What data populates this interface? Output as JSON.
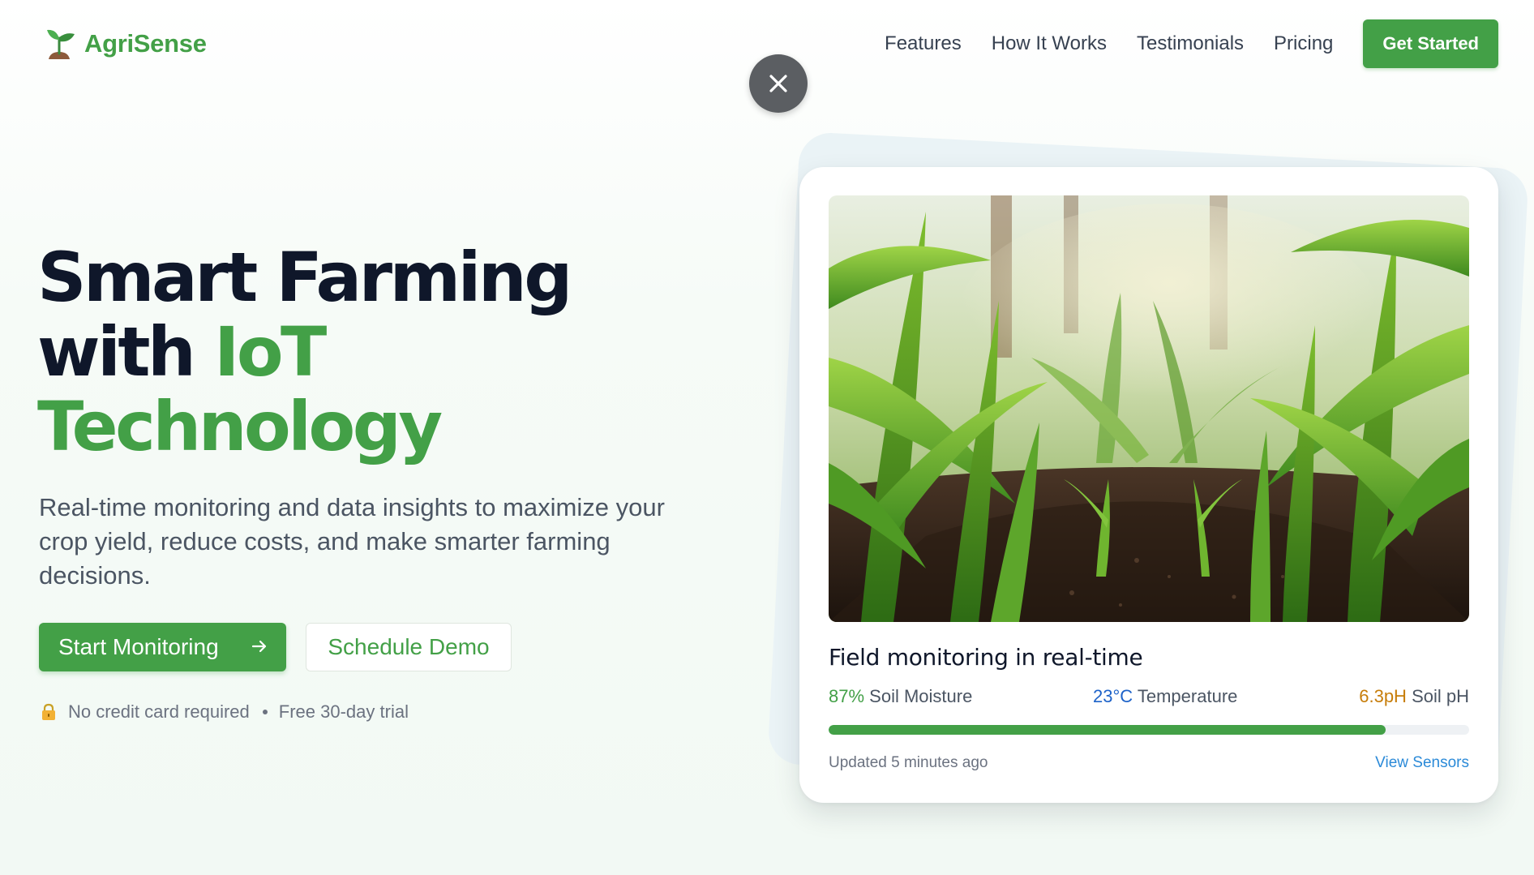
{
  "brand": {
    "name": "AgriSense",
    "accent": "#43a047"
  },
  "nav": {
    "items": [
      {
        "label": "Features"
      },
      {
        "label": "How It Works"
      },
      {
        "label": "Testimonials"
      },
      {
        "label": "Pricing"
      }
    ],
    "cta": "Get Started"
  },
  "hero": {
    "title_line1": "Smart Farming",
    "title_line2_a": "with ",
    "title_line2_b": "IoT",
    "title_line3": "Technology",
    "subtitle": "Real-time monitoring and data insights to maximize your crop yield, reduce costs, and make smarter farming decisions.",
    "primary_button": "Start Monitoring",
    "secondary_button": "Schedule Demo",
    "note_1": "No credit card required",
    "note_2": "Free 30-day trial"
  },
  "card": {
    "title": "Field monitoring in real-time",
    "metrics": [
      {
        "value": "87%",
        "label": "Soil Moisture",
        "color": "#43a047"
      },
      {
        "value": "23°C",
        "label": "Temperature",
        "color": "#1e63c9"
      },
      {
        "value": "6.3pH",
        "label": "Soil pH",
        "color": "#c77d0a"
      }
    ],
    "progress": 0.87,
    "updated": "Updated 5 minutes ago",
    "link": "View Sensors"
  },
  "icons": {
    "logo": "seedling-icon",
    "close": "close-icon",
    "arrow": "arrow-right-icon",
    "lock": "lock-icon"
  }
}
